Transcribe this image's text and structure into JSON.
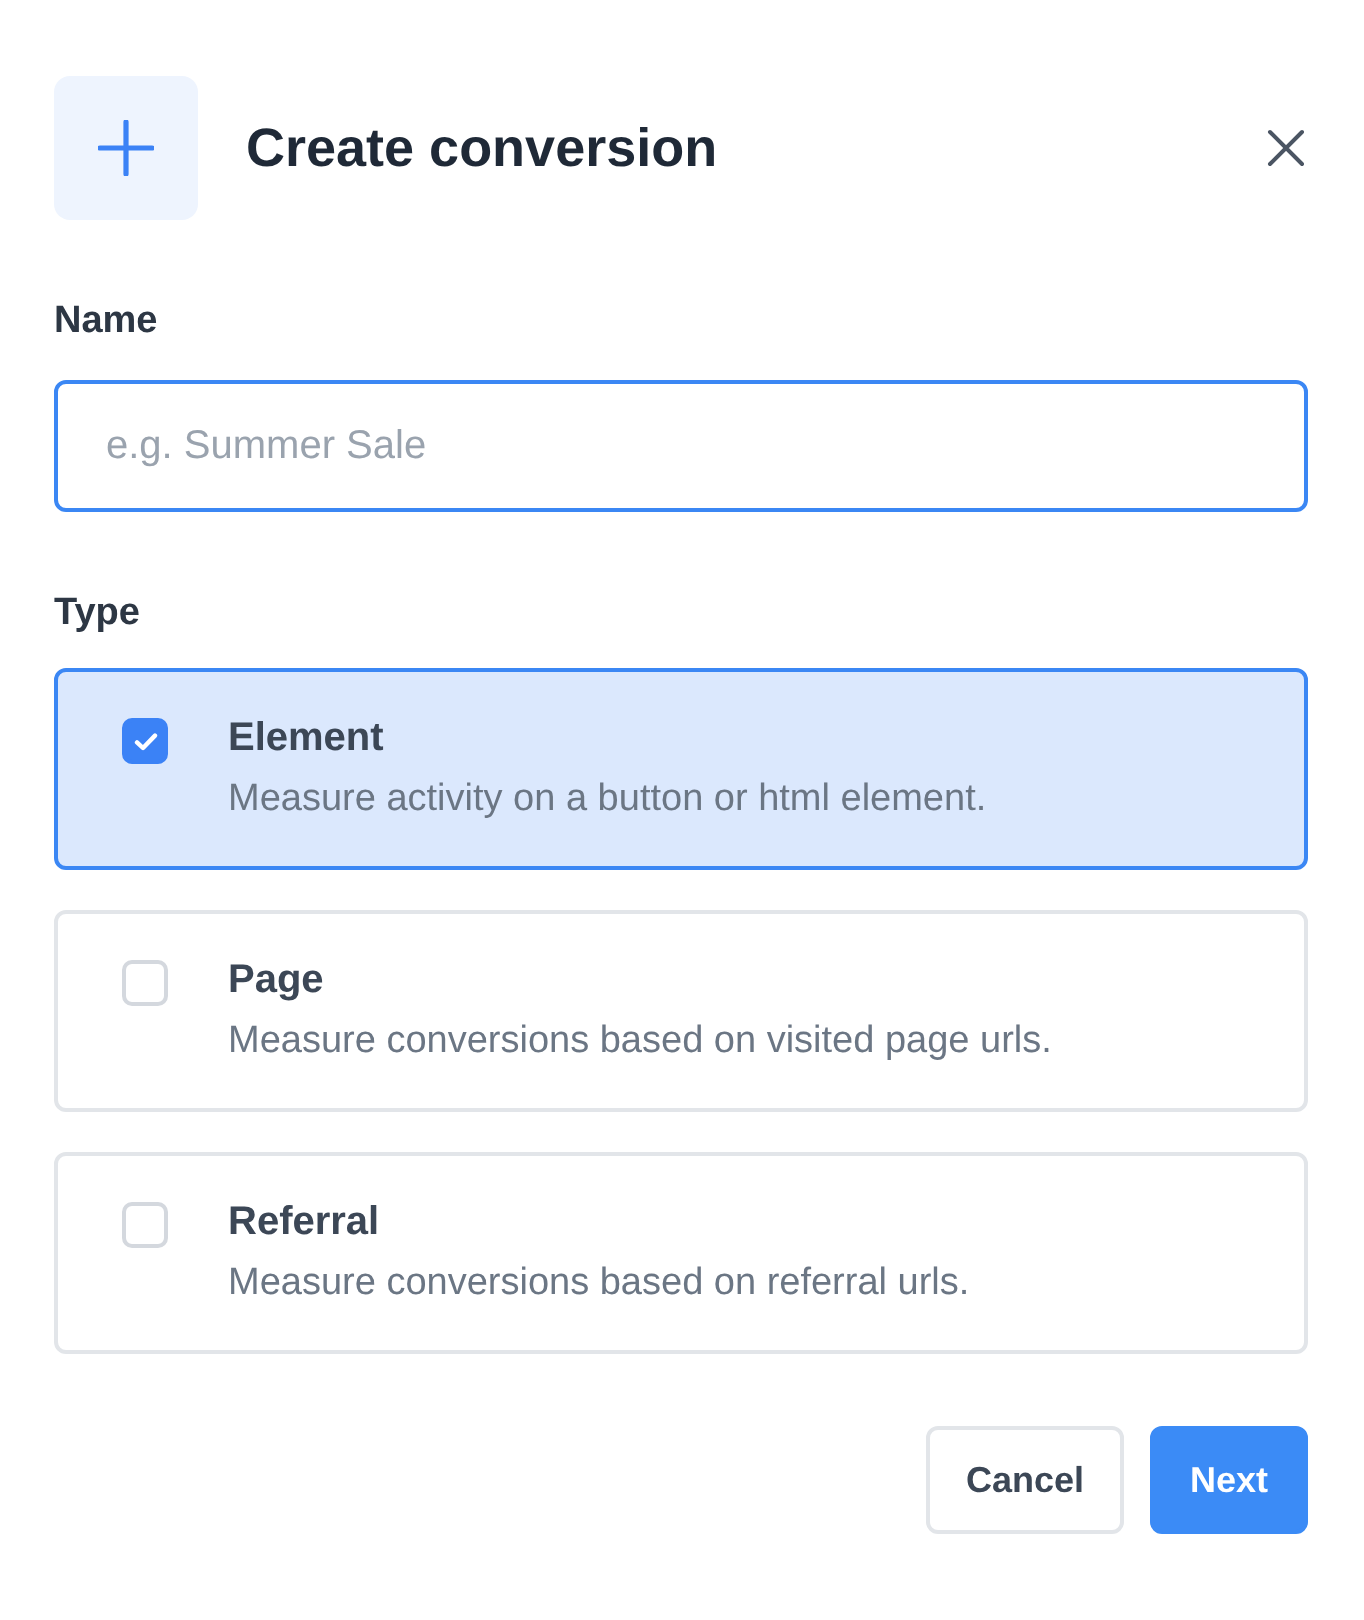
{
  "dialog": {
    "title": "Create conversion"
  },
  "name_field": {
    "label": "Name",
    "placeholder": "e.g. Summer Sale",
    "focused": true
  },
  "type_label": "Type",
  "options": [
    {
      "title": "Element",
      "description": "Measure activity on a button or html element.",
      "selected": true
    },
    {
      "title": "Page",
      "description": "Measure conversions based on visited page urls.",
      "selected": false
    },
    {
      "title": "Referral",
      "description": "Measure conversions based on referral urls.",
      "selected": false
    }
  ],
  "buttons": [
    {
      "label": "Cancel",
      "kind": "secondary"
    },
    {
      "label": "Next",
      "kind": "primary"
    }
  ]
}
